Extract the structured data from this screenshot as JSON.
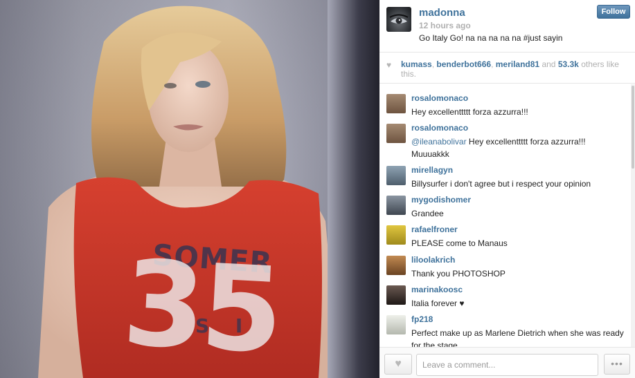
{
  "post": {
    "username": "madonna",
    "time_ago": "12 hours ago",
    "caption": "Go Italy Go! na na na na na #just sayin",
    "follow_label": "Follow",
    "shirt_text": "SOMER",
    "shirt_number": "35",
    "shirt_sub": "S I"
  },
  "likes": {
    "users": [
      "kumass",
      "benderbot666",
      "meriland81"
    ],
    "conjunction": "and",
    "count": "53.3k",
    "suffix": "others like this."
  },
  "comments": [
    {
      "user": "rosalomonaco",
      "mention": "",
      "text": "Hey excellenttttt forza azzurra!!!",
      "avatar_color": "#8a6e58"
    },
    {
      "user": "rosalomonaco",
      "mention": "@ileanabolivar",
      "text": " Hey excellenttttt forza azzurra!!! Muuuakkk",
      "avatar_color": "#8a6e58"
    },
    {
      "user": "mirellagyn",
      "mention": "",
      "text": "Billysurfer i don't agree but i respect your opinion",
      "avatar_color": "#6b7f8f"
    },
    {
      "user": "mygodishomer",
      "mention": "",
      "text": "Grandee",
      "avatar_color": "#5a6470"
    },
    {
      "user": "rafaelfroner",
      "mention": "",
      "text": "PLEASE come to Manaus",
      "avatar_color": "#c9b02a"
    },
    {
      "user": "liloolakrich",
      "mention": "",
      "text": "Thank you PHOTOSHOP",
      "avatar_color": "#9a6a3a"
    },
    {
      "user": "marinakoosc",
      "mention": "",
      "text": "Italia forever ♥",
      "avatar_color": "#3a2f2c"
    },
    {
      "user": "fp218",
      "mention": "",
      "text": "Perfect make up as Marlene Dietrich when she was ready for the stage.",
      "avatar_color": "#d8dcd2"
    }
  ],
  "footer": {
    "comment_placeholder": "Leave a comment...",
    "more_label": "•••"
  },
  "icons": {
    "heart": "heart-icon",
    "more": "ellipsis-icon"
  },
  "colors": {
    "link_blue": "#3f729b",
    "shirt_red": "#c4362a"
  }
}
